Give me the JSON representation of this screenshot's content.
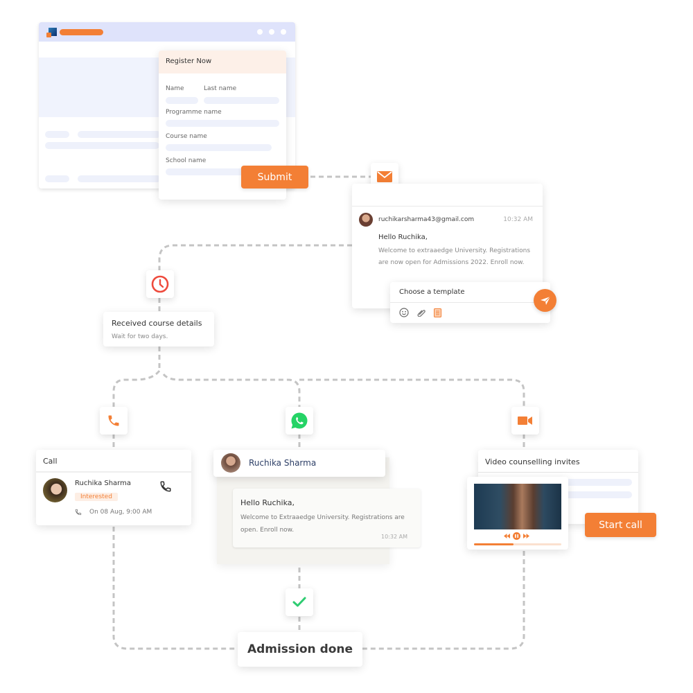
{
  "colors": {
    "accent": "#f37f35",
    "clock": "#ee4a3c",
    "whatsapp": "#25d366",
    "check": "#2ecc71",
    "dashed_line": "#c4c4c4",
    "browser_header": "#dfe3fb",
    "form_header": "#fdf0e8"
  },
  "registration": {
    "form_title": "Register Now",
    "fields": {
      "name": "Name",
      "last_name": "Last name",
      "programme": "Programme name",
      "course": "Course name",
      "school": "School name"
    },
    "submit_label": "Submit"
  },
  "email": {
    "icon": "envelope-icon",
    "sender": "ruchikarsharma43@gmail.com",
    "time": "10:32 AM",
    "greeting": "Hello Ruchika,",
    "body": "Welcome to extraaedge University. Registrations are now open for Admissions 2022. Enroll now.",
    "composer_placeholder": "Choose a template",
    "composer_icons": [
      "smiley-icon",
      "paperclip-icon",
      "template-icon"
    ],
    "send_icon": "send-icon"
  },
  "wait_step": {
    "icon": "clock-icon",
    "title": "Received course details",
    "subtitle": "Wait for two days."
  },
  "call": {
    "icon": "phone-icon",
    "title": "Call",
    "contact_name": "Ruchika Sharma",
    "status_badge": "Interested",
    "schedule": "On 08 Aug, 9:00 AM"
  },
  "whatsapp": {
    "icon": "whatsapp-icon",
    "contact_name": "Ruchika Sharma",
    "greeting": "Hello Ruchika,",
    "body": "Welcome to Extraaedge University. Registrations are  open. Enroll now.",
    "time": "10:32 AM"
  },
  "video": {
    "icon": "video-camera-icon",
    "title": "Video counselling invites",
    "start_call_label": "Start call",
    "progress_percent": 45
  },
  "final_step": {
    "icon": "check-icon",
    "title": "Admission done"
  }
}
